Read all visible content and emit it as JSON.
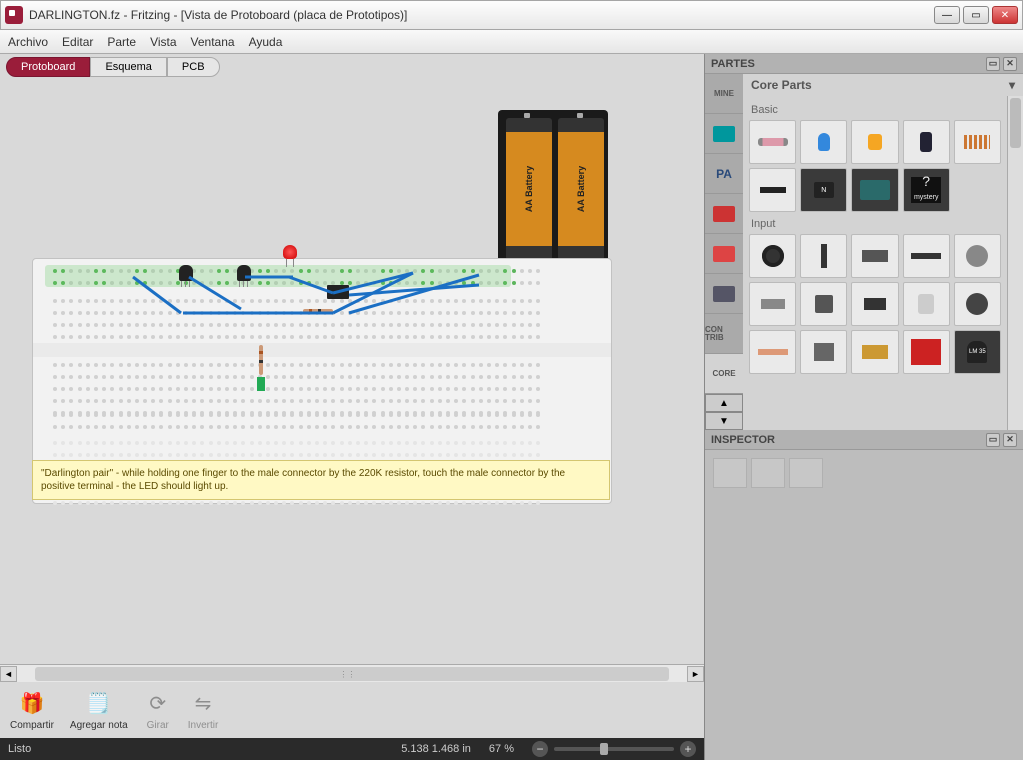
{
  "window": {
    "title": "DARLINGTON.fz - Fritzing - [Vista de Protoboard (placa de Prototipos)]"
  },
  "menu": {
    "items": [
      "Archivo",
      "Editar",
      "Parte",
      "Vista",
      "Ventana",
      "Ayuda"
    ]
  },
  "view_tabs": {
    "items": [
      {
        "label": "Protoboard",
        "active": true
      },
      {
        "label": "Esquema",
        "active": false
      },
      {
        "label": "PCB",
        "active": false
      }
    ]
  },
  "canvas": {
    "battery_label": "AA Battery",
    "note_text": "\"Darlington pair\" - while holding one finger to the male connector by the 220K resistor, touch the male connector by the positive terminal - the LED should light up."
  },
  "bottom_toolbar": {
    "items": [
      {
        "label": "Compartir",
        "icon": "gift",
        "disabled": false
      },
      {
        "label": "Agregar nota",
        "icon": "note",
        "disabled": false
      },
      {
        "label": "Girar",
        "icon": "rotate",
        "disabled": true
      },
      {
        "label": "Invertir",
        "icon": "flip",
        "disabled": true
      }
    ]
  },
  "statusbar": {
    "status": "Listo",
    "coords": "5.138 1.468 in",
    "zoom": "67 %"
  },
  "partes": {
    "header": "PARTES",
    "tabs": [
      "MINE",
      "",
      "PA",
      "",
      "",
      "",
      "CON TRIB",
      "CORE"
    ],
    "title": "Core Parts",
    "sections": [
      {
        "label": "Basic"
      },
      {
        "label": "Input"
      }
    ],
    "mystery_label": "mystery",
    "ic_label": "N",
    "sensor_label": "LM 35"
  },
  "inspector": {
    "header": "INSPECTOR"
  }
}
